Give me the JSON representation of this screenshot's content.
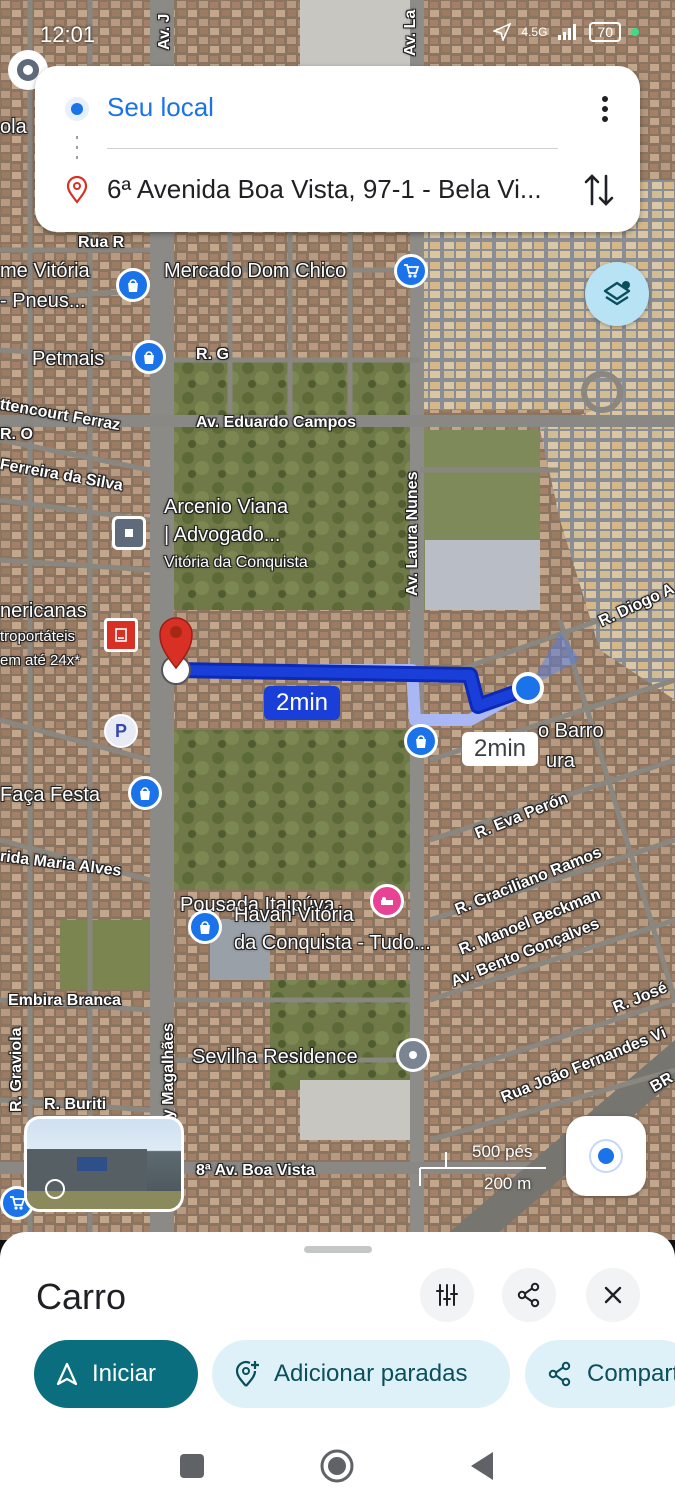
{
  "status_bar": {
    "time": "12:01",
    "network": "4.5G",
    "battery": "70"
  },
  "directions": {
    "origin": "Seu local",
    "destination": "6ª Avenida Boa Vista, 97-1 - Bela Vi..."
  },
  "map": {
    "labels": {
      "rua_r": "Rua R",
      "vitoria": "me Vitória",
      "pneus": "- Pneus...",
      "mercado": "Mercado Dom Chico",
      "petmais": "Petmais",
      "rg": "R. G",
      "bettencourt": "ttencourt Ferraz",
      "ro": "R. O",
      "ferreira": "Ferreira da Silva",
      "eduardo": "Av. Eduardo Campos",
      "arcenio1": "Arcenio Viana",
      "arcenio2": "| Advogado...",
      "arcenio3": "Vitória da Conquista",
      "laura": "Av. Laura Nunes",
      "americanas": "nericanas",
      "portateis": "troportáteis",
      "ate24": "em até 24x*",
      "diogo": "R. Diogo A",
      "barro": "o Barro",
      "ura": "ura",
      "eva": "R. Eva Perón",
      "faca": "Faça Festa",
      "maria": "rida Maria Alves",
      "graciliano": "R. Graciliano Ramos",
      "beckman": "R. Manoel Beckman",
      "bento": "Av. Bento Gonçalves",
      "pousada": "Pousada Itaipúva",
      "havan1": "Havan Vitória",
      "havan2": "da Conquista - Tudo...",
      "embira": "Embira Branca",
      "jose": "R. José",
      "joao": "Rua João Fernandes Vi",
      "graviola": "R. Graviola",
      "buriti": "R. Buriti",
      "sevilha": "Sevilha Residence",
      "magalhaes": "acy Magalhães",
      "boavista": "8ª Av. Boa Vista",
      "br": "BR",
      "avj": "Av. J",
      "avla": "Av. La",
      "ola": "ola"
    },
    "route_primary_time": "2min",
    "route_alt_time": "2min",
    "scale_ft": "500 pés",
    "scale_m": "200 m"
  },
  "sheet": {
    "mode": "Carro",
    "start": "Iniciar",
    "add_stops": "Adicionar paradas",
    "share": "Compartilhar"
  },
  "colors": {
    "accent": "#1a73e8",
    "route": "#1a3fd9",
    "start_chip": "#0b6e7f",
    "chip_bg": "#dff1f8"
  }
}
